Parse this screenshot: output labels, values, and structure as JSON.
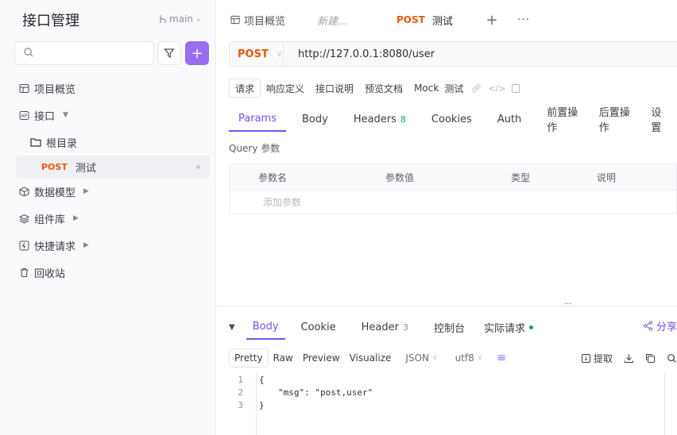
{
  "sidebar": {
    "title": "接口管理",
    "branch": "main",
    "items": [
      {
        "label": "项目概览"
      },
      {
        "label": "接口"
      },
      {
        "label": "根目录"
      },
      {
        "method": "POST",
        "label": "测试"
      },
      {
        "label": "数据模型"
      },
      {
        "label": "组件库"
      },
      {
        "label": "快捷请求"
      },
      {
        "label": "回收站"
      }
    ]
  },
  "tabs": {
    "overview": "项目概览",
    "new": "新建...",
    "active_method": "POST",
    "active_label": "测试"
  },
  "request": {
    "method": "POST",
    "url": "http://127.0.0.1:8080/user"
  },
  "subtabs": [
    "请求",
    "响应定义",
    "接口说明",
    "预览文档",
    "Mock",
    "测试"
  ],
  "param_tabs": {
    "params": "Params",
    "body": "Body",
    "headers": "Headers",
    "headers_count": "8",
    "cookies": "Cookies",
    "auth": "Auth",
    "pre": "前置操作",
    "post": "后置操作",
    "settings": "设置"
  },
  "query": {
    "label": "Query 参数",
    "columns": [
      "参数名",
      "参数值",
      "类型",
      "说明"
    ],
    "placeholder": "添加参数"
  },
  "response_tabs": {
    "body": "Body",
    "cookie": "Cookie",
    "header": "Header",
    "header_count": "3",
    "console": "控制台",
    "actual": "实际请求",
    "share": "分享"
  },
  "format_bar": {
    "pretty": "Pretty",
    "raw": "Raw",
    "preview": "Preview",
    "visualize": "Visualize",
    "type": "JSON",
    "encoding": "utf8",
    "extract": "提取"
  },
  "code": {
    "lines": [
      "1",
      "2",
      "3"
    ],
    "open": "{",
    "key": "\"msg\"",
    "colon": ": ",
    "value": "\"post,user\"",
    "close": "}"
  },
  "colors": {
    "accent": "#7c4ff0",
    "add_button": "#9b6bf0",
    "post_method": "#e8590c",
    "success": "#1aa36a"
  }
}
